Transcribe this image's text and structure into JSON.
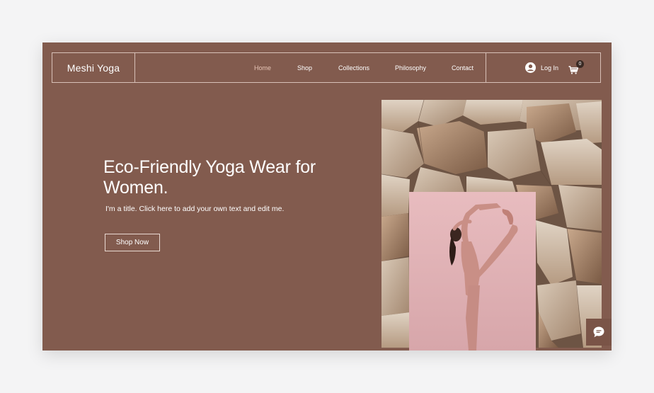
{
  "site": {
    "name": "Meshi Yoga"
  },
  "nav": {
    "items": [
      {
        "label": "Home",
        "active": true
      },
      {
        "label": "Shop",
        "active": false
      },
      {
        "label": "Collections",
        "active": false
      },
      {
        "label": "Philosophy",
        "active": false
      },
      {
        "label": "Contact",
        "active": false
      }
    ]
  },
  "account": {
    "login_label": "Log In",
    "cart_count": "0"
  },
  "hero": {
    "title": "Eco-Friendly Yoga Wear for Women.",
    "subtitle": "I'm a title. Click here to add your own text and edit me.",
    "cta_label": "Shop Now"
  },
  "icons": {
    "login": "user-circle-icon",
    "cart": "cart-icon",
    "chat": "chat-bubble-icon"
  },
  "colors": {
    "background": "#825b4e",
    "page": "#f4f4f5",
    "header_border": "#d8c0b7",
    "active_nav": "#e6c4b6",
    "accent_pink": "#e6b8bb"
  }
}
